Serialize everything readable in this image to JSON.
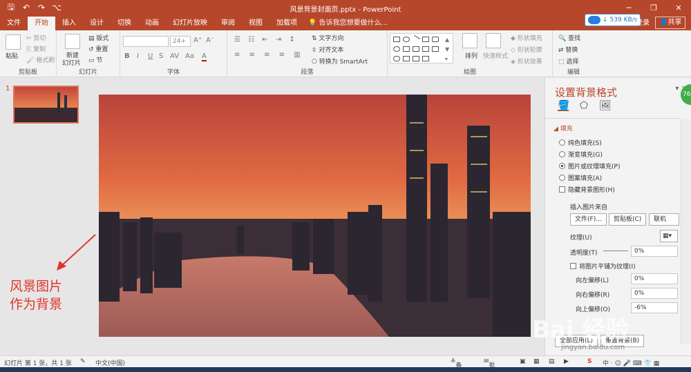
{
  "window": {
    "title": "风景背景封面页.pptx - PowerPoint",
    "minimize": "─",
    "maximize": "❐",
    "close": "✕"
  },
  "qat": {
    "save": "🖫",
    "undo": "↶",
    "redo": "↷",
    "start": "⌥"
  },
  "tabs": [
    "文件",
    "开始",
    "插入",
    "设计",
    "切换",
    "动画",
    "幻灯片放映",
    "审阅",
    "视图",
    "加载项"
  ],
  "active_tab": "开始",
  "tell_me": "告诉我您想要做什么...",
  "speed": "539 KB/s",
  "account": {
    "login": "登录",
    "share": "共享"
  },
  "ribbon": {
    "clipboard": {
      "label": "剪贴板",
      "paste": "粘贴",
      "cut": "剪切",
      "copy": "复制",
      "format_painter": "格式刷"
    },
    "slides": {
      "label": "幻灯片",
      "new_slide": "新建",
      "new_slide2": "幻灯片",
      "layout": "版式",
      "reset": "重置",
      "section": "节"
    },
    "font": {
      "label": "字体",
      "size": "24+",
      "bold": "B",
      "italic": "I",
      "underline": "U",
      "strike": "S",
      "spacing": "AV",
      "case": "Aa",
      "color": "A"
    },
    "paragraph": {
      "label": "段落",
      "text_direction": "文字方向",
      "align_text": "对齐文本",
      "smartart": "转换为 SmartArt"
    },
    "drawing": {
      "label": "绘图",
      "arrange": "排列",
      "quick_styles": "快速样式",
      "fill": "形状填充",
      "outline": "形状轮廓",
      "effects": "形状效果"
    },
    "editing": {
      "label": "编辑",
      "find": "查找",
      "replace": "替换",
      "select": "选择"
    }
  },
  "thumbnail": {
    "number": "1"
  },
  "annotation": {
    "line1": "风景图片",
    "line2": "作为背景"
  },
  "pane": {
    "title": "设置背景格式",
    "fill_section": "填充",
    "options": {
      "solid": "纯色填充(S)",
      "gradient": "渐变填充(G)",
      "picture": "图片或纹理填充(P)",
      "pattern": "图案填充(A)"
    },
    "selected_option": "picture",
    "hide_bg": "隐藏背景图形(H)",
    "insert_from": "插入图片来自",
    "file_btn": "文件(F)...",
    "clipboard_btn": "剪贴板(C)",
    "online_btn": "联机(E)...",
    "texture": "纹理(U)",
    "transparency": "透明度(T)",
    "transparency_value": "0%",
    "tile": "将图片平铺为纹理(I)",
    "offset_left": "向左偏移(L)",
    "offset_left_value": "0%",
    "offset_right": "向右偏移(R)",
    "offset_right_value": "0%",
    "offset_top": "向上偏移(O)",
    "offset_top_value": "-6%",
    "apply_all": "全部应用(L)",
    "reset_bg": "重置背景(B)",
    "badge": "76"
  },
  "status": {
    "slide_info": "幻灯片 第 1 张，共 1 张",
    "language": "中文(中国)",
    "notes": "备注",
    "comments": "批注"
  },
  "watermark": {
    "text": "Bai 经验",
    "sub": "jingyan.baidu.com"
  },
  "colors": {
    "accent": "#b7472a",
    "annotation": "#e2332b"
  }
}
